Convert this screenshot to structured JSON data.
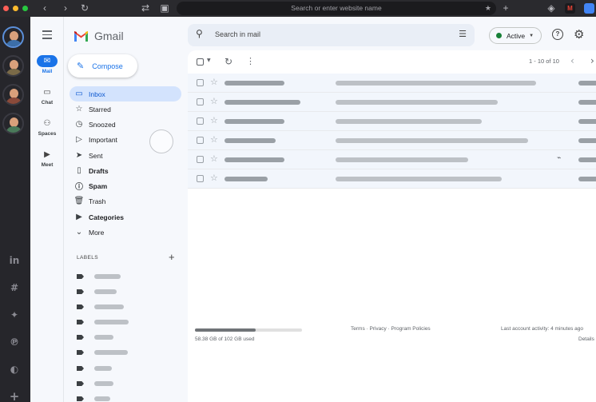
{
  "browser": {
    "url_placeholder": "Search or enter website name",
    "traffic_colors": [
      "#ff5f57",
      "#febc2e",
      "#28c840"
    ]
  },
  "rail": {
    "avatars": [
      {
        "name": "avatar-1",
        "shirt": "#3c6ea8"
      },
      {
        "name": "avatar-2",
        "shirt": "#7a6a48"
      },
      {
        "name": "avatar-3",
        "shirt": "#8a4a3a"
      },
      {
        "name": "avatar-4",
        "shirt": "#4a7a5a"
      }
    ],
    "apps": [
      "linkedin-icon",
      "slack-icon",
      "twitter-icon",
      "pinterest-icon",
      "messenger-icon",
      "add-icon"
    ]
  },
  "nav": {
    "mail": "Mail",
    "chat": "Chat",
    "spaces": "Spaces",
    "meet": "Meet"
  },
  "header": {
    "logo_text": "Gmail",
    "search_placeholder": "Search in mail",
    "status": "Active"
  },
  "sidebar": {
    "compose": "Compose",
    "items": [
      {
        "label": "Inbox",
        "icon": "inbox-icon",
        "glyph": "▭",
        "active": true,
        "bold": false
      },
      {
        "label": "Starred",
        "icon": "star-icon",
        "glyph": "☆",
        "active": false,
        "bold": false
      },
      {
        "label": "Snoozed",
        "icon": "clock-icon",
        "glyph": "◷",
        "active": false,
        "bold": false
      },
      {
        "label": "Important",
        "icon": "important-icon",
        "glyph": "▷",
        "active": false,
        "bold": false
      },
      {
        "label": "Sent",
        "icon": "send-icon",
        "glyph": "➤",
        "active": false,
        "bold": false
      },
      {
        "label": "Drafts",
        "icon": "draft-icon",
        "glyph": "▯",
        "active": false,
        "bold": true
      },
      {
        "label": "Spam",
        "icon": "spam-icon",
        "glyph": "ⓘ",
        "active": false,
        "bold": true
      },
      {
        "label": "Trash",
        "icon": "trash-icon",
        "glyph": "🗑",
        "active": false,
        "bold": false
      },
      {
        "label": "Categories",
        "icon": "label-icon",
        "glyph": "▶",
        "active": false,
        "bold": true
      },
      {
        "label": "More",
        "icon": "chevron-down-icon",
        "glyph": "⌄",
        "active": false,
        "bold": false
      }
    ],
    "labels_header": "LABELS"
  },
  "inbox": {
    "pager": "1 - 10 of 10"
  },
  "footer": {
    "storage_used_fraction": 0.57,
    "storage": "58.38 GB of 102 GB used",
    "links": "Terms · Privacy · Program Policies",
    "activity": "Last account activity: 4 minutes ago",
    "details": "Details"
  }
}
